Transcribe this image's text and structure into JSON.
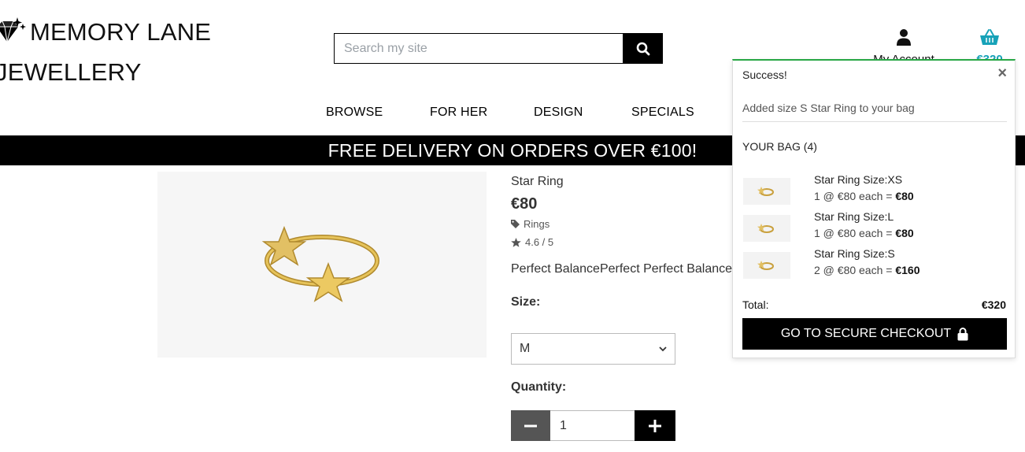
{
  "brand": {
    "line1": "MEMORY LANE",
    "line2": "JEWELLERY"
  },
  "search": {
    "placeholder": "Search my site",
    "value": ""
  },
  "header": {
    "account_label": "My Account",
    "bag_total": "€320"
  },
  "nav": {
    "items": [
      "BROWSE",
      "FOR HER",
      "DESIGN",
      "SPECIALS"
    ]
  },
  "banner": {
    "text": "FREE DELIVERY ON ORDERS OVER €100!"
  },
  "product": {
    "name": "Star Ring",
    "price": "€80",
    "category": "Rings",
    "rating": "4.6 / 5",
    "description": "Perfect BalancePerfect Perfect Balance",
    "size_label": "Size:",
    "size_value": "M",
    "quantity_label": "Quantity:",
    "quantity_value": "1"
  },
  "toast": {
    "title": "Success!",
    "message": "Added size S Star Ring to your bag",
    "bag_label": "YOUR BAG (4)",
    "items": [
      {
        "title": "Star Ring Size:XS",
        "detail": "1 @ €80 each = ",
        "subtotal": "€80"
      },
      {
        "title": "Star Ring Size:L",
        "detail": "1 @ €80 each = ",
        "subtotal": "€80"
      },
      {
        "title": "Star Ring Size:S",
        "detail": "2 @ €80 each = ",
        "subtotal": "€160"
      }
    ],
    "total_label": "Total:",
    "total_value": "€320",
    "checkout_label": "GO TO SECURE CHECKOUT"
  },
  "colors": {
    "accent": "#17a2b8",
    "success": "#28a745",
    "gold": "#d4a93a"
  },
  "icons": [
    "diamond-icon",
    "search-icon",
    "user-icon",
    "basket-icon",
    "tag-icon",
    "star-icon",
    "close-icon",
    "lock-icon",
    "minus-icon",
    "plus-icon",
    "chevron-down-icon"
  ]
}
